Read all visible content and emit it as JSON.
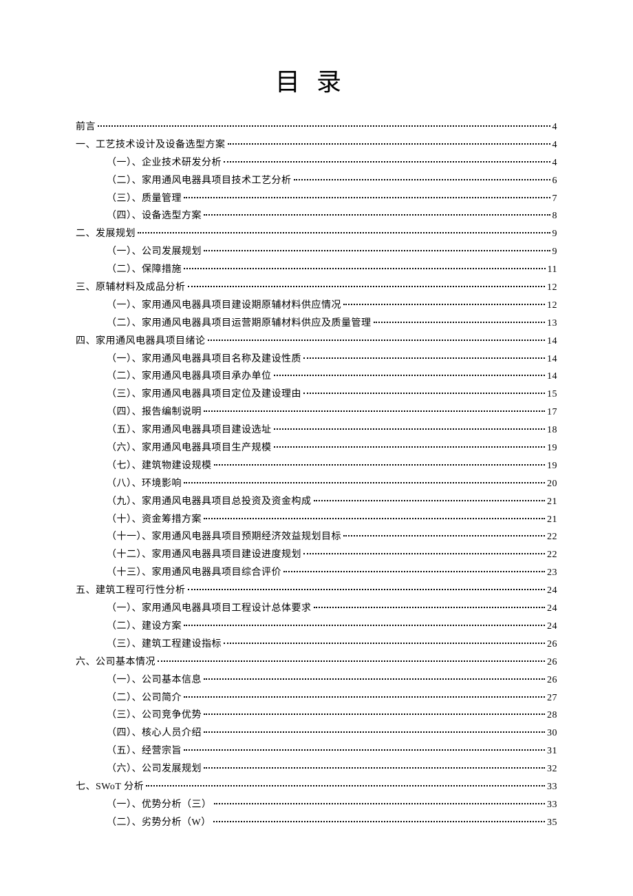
{
  "title": "目录",
  "toc": [
    {
      "level": 1,
      "label": "前言",
      "page": "4"
    },
    {
      "level": 1,
      "label": "一、工艺技术设计及设备选型方案",
      "page": "4"
    },
    {
      "level": 2,
      "label": "（一）、企业技术研发分析",
      "page": "4"
    },
    {
      "level": 2,
      "label": "（二）、家用通风电器具项目技术工艺分析",
      "page": "6"
    },
    {
      "level": 2,
      "label": "（三）、质量管理",
      "page": "7"
    },
    {
      "level": 2,
      "label": "（四）、设备选型方案",
      "page": "8"
    },
    {
      "level": 1,
      "label": "二、发展规划",
      "page": "9"
    },
    {
      "level": 2,
      "label": "（一）、公司发展规划",
      "page": "9"
    },
    {
      "level": 2,
      "label": "（二）、保障措施",
      "page": "11"
    },
    {
      "level": 1,
      "label": "三、原辅材料及成品分析",
      "page": "12"
    },
    {
      "level": 2,
      "label": "（一）、家用通风电器具项目建设期原辅材料供应情况",
      "page": "12"
    },
    {
      "level": 2,
      "label": "（二）、家用通风电器具项目运营期原辅材料供应及质量管理",
      "page": "13"
    },
    {
      "level": 1,
      "label": "四、家用通风电器具项目绪论",
      "page": "14"
    },
    {
      "level": 2,
      "label": "（一）、家用通风电器具项目名称及建设性质",
      "page": "14"
    },
    {
      "level": 2,
      "label": "（二）、家用通风电器具项目承办单位",
      "page": "14"
    },
    {
      "level": 2,
      "label": "（三）、家用通风电器具项目定位及建设理由",
      "page": "15"
    },
    {
      "level": 2,
      "label": "（四）、报告编制说明",
      "page": "17"
    },
    {
      "level": 2,
      "label": "（五）、家用通风电器具项目建设选址",
      "page": "18"
    },
    {
      "level": 2,
      "label": "（六）、家用通风电器具项目生产规模",
      "page": "19"
    },
    {
      "level": 2,
      "label": "（七）、建筑物建设规模",
      "page": "19"
    },
    {
      "level": 2,
      "label": "（八）、环境影响",
      "page": "20"
    },
    {
      "level": 2,
      "label": "（九）、家用通风电器具项目总投资及资金构成",
      "page": "21"
    },
    {
      "level": 2,
      "label": "（十）、资金筹措方案",
      "page": "21"
    },
    {
      "level": 2,
      "label": "（十一）、家用通风电器具项目预期经济效益规划目标",
      "page": "22"
    },
    {
      "level": 2,
      "label": "（十二）、家用通风电器具项目建设进度规划",
      "page": "22"
    },
    {
      "level": 2,
      "label": "（十三）、家用通风电器具项目综合评价",
      "page": "23"
    },
    {
      "level": 1,
      "label": "五、建筑工程可行性分析",
      "page": "24"
    },
    {
      "level": 2,
      "label": "（一）、家用通风电器具项目工程设计总体要求",
      "page": "24"
    },
    {
      "level": 2,
      "label": "（二）、建设方案",
      "page": "24"
    },
    {
      "level": 2,
      "label": "（三）、建筑工程建设指标",
      "page": "26"
    },
    {
      "level": 1,
      "label": "六、公司基本情况",
      "page": "26"
    },
    {
      "level": 2,
      "label": "（一）、公司基本信息",
      "page": "26"
    },
    {
      "level": 2,
      "label": "（二）、公司简介",
      "page": "27"
    },
    {
      "level": 2,
      "label": "（三）、公司竞争优势",
      "page": "28"
    },
    {
      "level": 2,
      "label": "（四）、核心人员介绍",
      "page": "30"
    },
    {
      "level": 2,
      "label": "（五）、经营宗旨",
      "page": "31"
    },
    {
      "level": 2,
      "label": "（六）、公司发展规划",
      "page": "32"
    },
    {
      "level": 1,
      "label": "七、SWoT 分析",
      "page": "33"
    },
    {
      "level": 2,
      "label": "（一）、优势分析（三）",
      "page": "33"
    },
    {
      "level": 2,
      "label": "（二）、劣势分析（W）",
      "page": "35"
    }
  ]
}
